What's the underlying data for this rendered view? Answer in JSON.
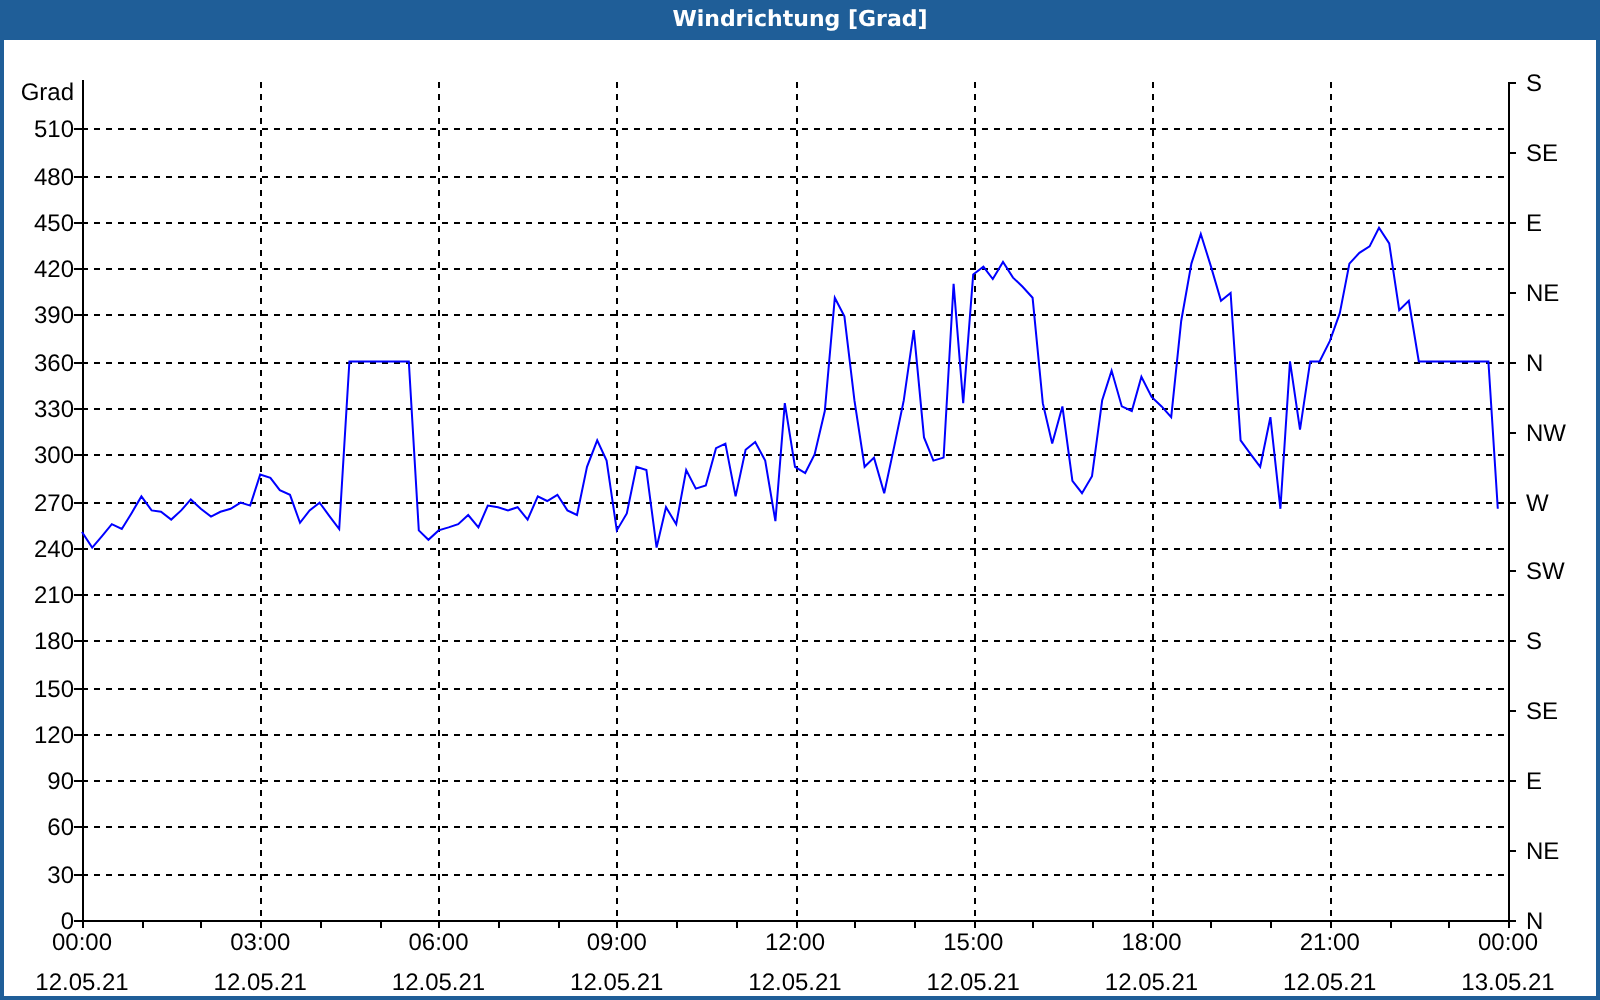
{
  "window": {
    "title": "Windrichtung [Grad]"
  },
  "chart": {
    "chart_data": {
      "type": "line",
      "grid": true,
      "ylabel": "Grad",
      "xlim": [
        0,
        24
      ],
      "ylim": [
        0,
        540
      ],
      "xticks": [
        {
          "value": 0,
          "label": "00:00"
        },
        {
          "value": 3,
          "label": "03:00"
        },
        {
          "value": 6,
          "label": "06:00"
        },
        {
          "value": 9,
          "label": "09:00"
        },
        {
          "value": 12,
          "label": "12:00"
        },
        {
          "value": 15,
          "label": "15:00"
        },
        {
          "value": 18,
          "label": "18:00"
        },
        {
          "value": 21,
          "label": "21:00"
        },
        {
          "value": 24,
          "label": "00:00"
        }
      ],
      "yticks": [
        0,
        30,
        60,
        90,
        120,
        150,
        180,
        210,
        240,
        270,
        300,
        330,
        360,
        390,
        420,
        450,
        480,
        510
      ],
      "x": [
        0,
        0.17,
        0.33,
        0.5,
        0.67,
        0.83,
        1,
        1.17,
        1.33,
        1.5,
        1.67,
        1.83,
        2,
        2.17,
        2.33,
        2.5,
        2.67,
        2.83,
        3,
        3.17,
        3.33,
        3.5,
        3.67,
        3.83,
        4,
        4.17,
        4.33,
        4.5,
        4.67,
        4.83,
        5,
        5.17,
        5.33,
        5.5,
        5.67,
        5.83,
        6,
        6.17,
        6.33,
        6.5,
        6.67,
        6.83,
        7,
        7.17,
        7.33,
        7.5,
        7.67,
        7.83,
        8,
        8.17,
        8.33,
        8.5,
        8.67,
        8.83,
        9,
        9.17,
        9.33,
        9.5,
        9.67,
        9.83,
        10,
        10.17,
        10.33,
        10.5,
        10.67,
        10.83,
        11,
        11.17,
        11.33,
        11.5,
        11.67,
        11.83,
        12,
        12.17,
        12.33,
        12.5,
        12.67,
        12.83,
        13,
        13.17,
        13.33,
        13.5,
        13.67,
        13.83,
        14,
        14.17,
        14.33,
        14.5,
        14.67,
        14.83,
        15,
        15.17,
        15.33,
        15.5,
        15.67,
        15.83,
        16,
        16.17,
        16.33,
        16.5,
        16.67,
        16.83,
        17,
        17.17,
        17.33,
        17.5,
        17.67,
        17.83,
        18,
        18.17,
        18.33,
        18.5,
        18.67,
        18.83,
        19,
        19.17,
        19.33,
        19.5,
        19.67,
        19.83,
        20,
        20.17,
        20.33,
        20.5,
        20.67,
        20.83,
        21,
        21.17,
        21.33,
        21.5,
        21.67,
        21.83,
        22,
        22.17,
        22.33,
        22.5,
        22.67,
        22.83,
        23,
        23.17,
        23.33,
        23.5,
        23.67,
        23.83
      ],
      "series": [
        {
          "color": "#0000ff",
          "values": [
            250,
            240,
            247,
            255,
            252,
            262,
            273,
            264,
            263,
            258,
            264,
            271,
            265,
            260,
            263,
            265,
            269,
            267,
            287,
            285,
            277,
            274,
            256,
            264,
            269,
            260,
            252,
            360,
            360,
            360,
            360,
            360,
            360,
            360,
            251,
            245,
            251,
            253,
            255,
            261,
            253,
            267,
            266,
            264,
            266,
            258,
            273,
            270,
            274,
            264,
            261,
            292,
            309,
            296,
            251,
            262,
            292,
            290,
            240,
            266,
            255,
            290,
            278,
            280,
            304,
            307,
            273,
            303,
            308,
            296,
            257,
            333,
            292,
            288,
            300,
            328,
            401,
            389,
            335,
            292,
            298,
            275,
            305,
            335,
            380,
            311,
            296,
            298,
            410,
            333,
            416,
            421,
            413,
            424,
            414,
            408,
            401,
            333,
            307,
            331,
            283,
            275,
            286,
            335,
            354,
            331,
            328,
            350,
            337,
            331,
            324,
            386,
            423,
            442,
            421,
            399,
            404,
            309,
            300,
            292,
            324,
            265,
            360,
            316,
            360,
            360,
            373,
            391,
            423,
            430,
            434,
            446,
            436,
            393,
            399,
            360,
            360,
            360,
            360,
            360,
            360,
            360,
            360,
            265
          ]
        }
      ]
    },
    "x_dates": [
      "12.05.21",
      "12.05.21",
      "12.05.21",
      "12.05.21",
      "12.05.21",
      "12.05.21",
      "12.05.21",
      "12.05.21",
      "13.05.21"
    ],
    "compass_labels": [
      "S",
      "SE",
      "E",
      "NE",
      "N",
      "NW",
      "W",
      "SW",
      "S",
      "SE",
      "E",
      "NE",
      "N"
    ]
  }
}
